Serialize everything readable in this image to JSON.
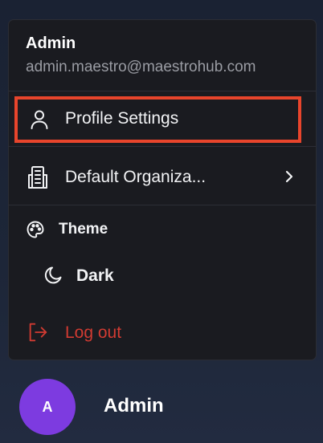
{
  "user": {
    "name": "Admin",
    "email": "admin.maestro@maestrohub.com"
  },
  "menu": {
    "profile": {
      "label": "Profile Settings",
      "icon": "user-icon",
      "highlighted": true,
      "highlight_color": "#e8452c"
    },
    "organization": {
      "label": "Default Organiza...",
      "icon": "building-icon",
      "chevron": "chevron-right-icon"
    },
    "theme_section": {
      "label": "Theme",
      "icon": "palette-icon"
    },
    "theme_option": {
      "label": "Dark",
      "icon": "moon-icon"
    },
    "logout": {
      "label": "Log out",
      "icon": "logout-icon",
      "color": "#d23b32"
    }
  },
  "footer": {
    "avatar_initial": "A",
    "avatar_color": "#7d3be0",
    "name": "Admin"
  }
}
